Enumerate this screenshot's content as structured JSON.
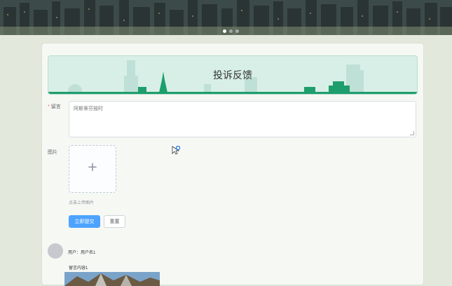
{
  "banner": {
    "slide_count": 3,
    "active_slide": 1
  },
  "form": {
    "title": "投诉反馈",
    "message_label": "留言",
    "required_marker": "*",
    "message_value": "阿斯蒂芬按时",
    "image_label": "图片",
    "upload_icon": "plus-icon",
    "upload_hint": "点击上传图片",
    "submit_label": "立即提交",
    "reset_label": "重置"
  },
  "comments": [
    {
      "user_line": "用户：用户名1",
      "message_line": "留言内容1"
    }
  ],
  "colors": {
    "primary": "#4da3ff",
    "title_bg": "#d8efe7",
    "required": "#f56c6c"
  }
}
